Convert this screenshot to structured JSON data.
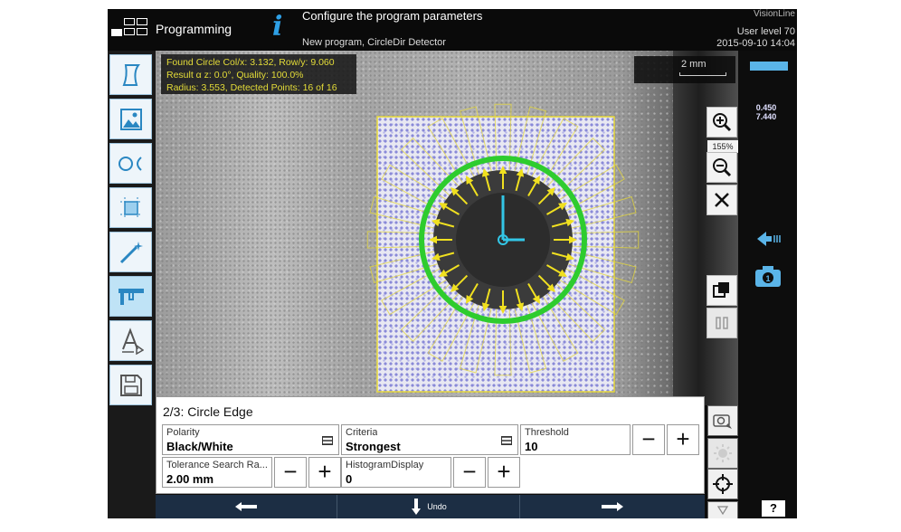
{
  "header": {
    "mode": "Programming",
    "info_icon": "i",
    "title": "Configure the program parameters",
    "subtitle": "New program, CircleDir Detector",
    "brand": "VisionLine",
    "user_level": "User level 70",
    "datetime": "2015-09-10 14:04"
  },
  "left_toolbar": {
    "items": [
      "shape-icon",
      "image-icon",
      "circle-detect-icon",
      "crop-icon",
      "magic-wand-icon",
      "caliper-icon",
      "text-tool-icon",
      "save-icon"
    ]
  },
  "result": {
    "line1": "Found Circle Col/x: 3.132, Row/y: 9.060",
    "line2": "Result α z: 0.0°, Quality: 100.0%",
    "line3": "Radius: 3.553, Detected Points: 16 of 16"
  },
  "scale": {
    "label": "2 mm"
  },
  "zoom": {
    "level": "155%"
  },
  "side": {
    "coord_x": "0.450",
    "coord_y": "7.440"
  },
  "params": {
    "title": "2/3: Circle Edge",
    "polarity": {
      "label": "Polarity",
      "value": "Black/White"
    },
    "criteria": {
      "label": "Criteria",
      "value": "Strongest"
    },
    "threshold": {
      "label": "Threshold",
      "value": "10"
    },
    "tolerance": {
      "label": "Tolerance Search Ra...",
      "value": "2.00 mm"
    },
    "histogram": {
      "label": "HistogramDisplay",
      "value": "0"
    },
    "minus": "−",
    "plus": "+"
  },
  "bottom": {
    "undo": "Undo"
  },
  "help": "?",
  "colors": {
    "accent": "#2ea0e6",
    "detect": "#2ecc2e",
    "arrows": "#f0e020",
    "nav": "#1c2e44"
  }
}
